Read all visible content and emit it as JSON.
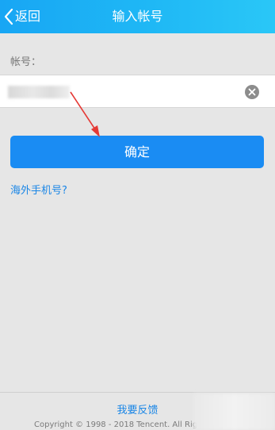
{
  "header": {
    "back_label": "返回",
    "title": "输入帐号"
  },
  "form": {
    "account_label": "帐号：",
    "account_value": "",
    "clear_icon": "clear-icon",
    "confirm_label": "确定",
    "overseas_link": "海外手机号?"
  },
  "footer": {
    "feedback_link": "我要反馈",
    "copyright": "Copyright © 1998 - 2018 Tencent. All Rig"
  },
  "colors": {
    "header_start": "#18a6f4",
    "header_end": "#2ac7f7",
    "primary_button": "#1a8cf3",
    "link": "#1a86e6",
    "annotation_arrow": "#e53935"
  }
}
